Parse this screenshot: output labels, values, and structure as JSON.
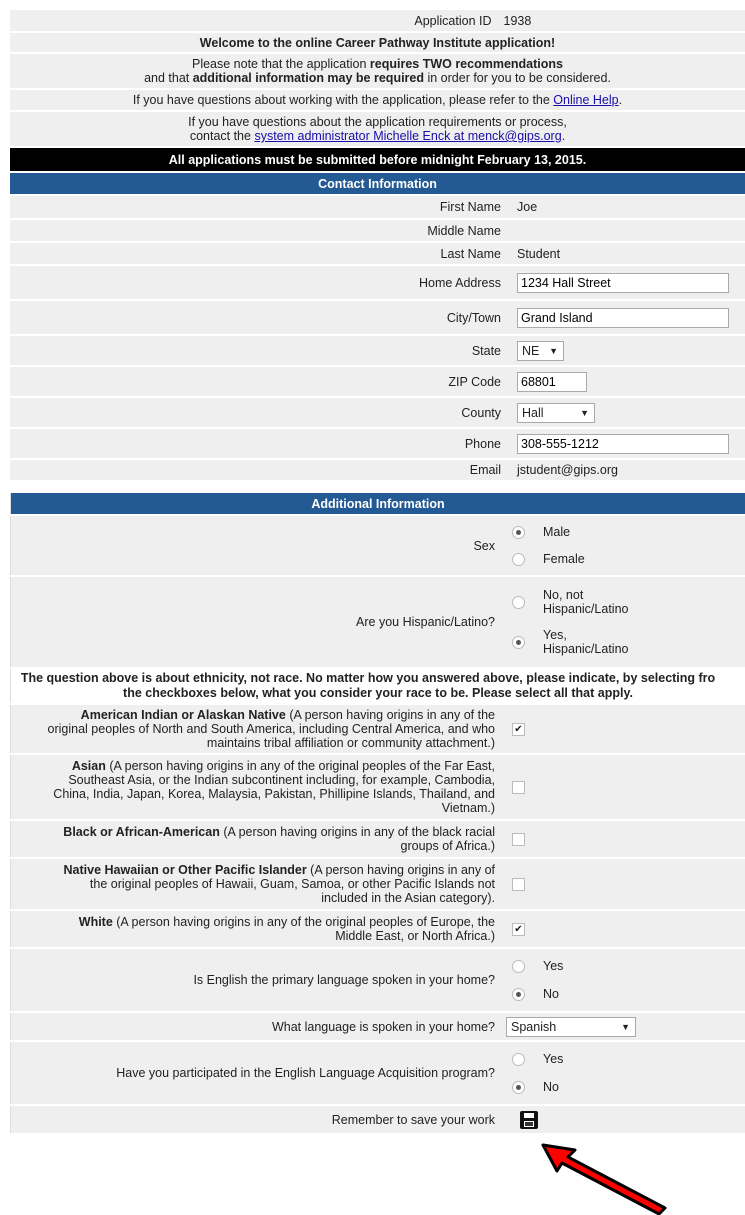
{
  "header": {
    "app_id_label": "Application ID",
    "app_id_value": "1938",
    "welcome": "Welcome to the online Career Pathway Institute application!",
    "note_line1_a": "Please note that the application ",
    "note_line1_b": "requires TWO recommendations",
    "note_line2_a": "and that ",
    "note_line2_b": "additional information may be required",
    "note_line2_c": " in order for you to be considered.",
    "help_text": "If you have questions about working with the application, please refer to the ",
    "help_link": "Online Help",
    "help_end": ".",
    "req_line1": "If you have questions about the application requirements or process,",
    "req_line2_a": "contact the ",
    "req_link": "system administrator Michelle Enck at menck@gips.org",
    "req_end": ".",
    "deadline": "All applications must be submitted before midnight February 13, 2015."
  },
  "contact": {
    "title": "Contact Information",
    "first_name_label": "First Name",
    "first_name": "Joe",
    "middle_name_label": "Middle Name",
    "middle_name": "",
    "last_name_label": "Last Name",
    "last_name": "Student",
    "address_label": "Home Address",
    "address": "1234 Hall Street",
    "city_label": "City/Town",
    "city": "Grand Island",
    "state_label": "State",
    "state": "NE",
    "zip_label": "ZIP Code",
    "zip": "68801",
    "county_label": "County",
    "county": "Hall",
    "phone_label": "Phone",
    "phone": "308-555-1212",
    "email_label": "Email",
    "email": "jstudent@gips.org"
  },
  "additional": {
    "title": "Additional Information",
    "sex_label": "Sex",
    "sex_options": [
      "Male",
      "Female"
    ],
    "sex_selected": "Male",
    "hisp_label": "Are you Hispanic/Latino?",
    "hisp_opt_no_1": "No, not",
    "hisp_opt_no_2": "Hispanic/Latino",
    "hisp_opt_yes_1": "Yes,",
    "hisp_opt_yes_2": "Hispanic/Latino",
    "hisp_selected": "Yes, Hispanic/Latino",
    "race_note_1": "The question above is about ethnicity, not race. No matter how you answered above, please indicate, by selecting fro",
    "race_note_2": "the checkboxes below, what you consider your race to be. Please select all that apply.",
    "races": [
      {
        "name": "American Indian or Alaskan Native",
        "desc_a": " (A person having origins in any of the",
        "desc_b": "original peoples of North and South America, including Central America, and who",
        "desc_c": "maintains tribal affiliation or community attachment.)",
        "desc_d": "",
        "checked": true
      },
      {
        "name": "Asian",
        "desc_a": " (A person having origins in any of the original peoples of the Far East,",
        "desc_b": "Southeast Asia, or the Indian subcontinent including, for example, Cambodia,",
        "desc_c": "China, India, Japan, Korea, Malaysia, Pakistan, Phillipine Islands, Thailand, and",
        "desc_d": "Vietnam.)",
        "checked": false
      },
      {
        "name": "Black or African-American",
        "desc_a": " (A person having origins in any of the black racial",
        "desc_b": "groups of Africa.)",
        "desc_c": "",
        "desc_d": "",
        "checked": false
      },
      {
        "name": "Native Hawaiian or Other Pacific Islander",
        "desc_a": " (A person having origins in any of",
        "desc_b": "the original peoples of Hawaii, Guam, Samoa, or other Pacific Islands not",
        "desc_c": "included in the Asian category).",
        "desc_d": "",
        "checked": false
      },
      {
        "name": "White",
        "desc_a": " (A person having origins in any of the original peoples of Europe, the",
        "desc_b": "Middle East, or North Africa.)",
        "desc_c": "",
        "desc_d": "",
        "checked": true
      }
    ],
    "english_label": "Is English the primary language spoken in your home?",
    "english_options": [
      "Yes",
      "No"
    ],
    "english_selected": "No",
    "language_label": "What language is spoken in your home?",
    "language": "Spanish",
    "ela_label": "Have you participated in the English Language Acquisition program?",
    "ela_options": [
      "Yes",
      "No"
    ],
    "ela_selected": "No",
    "save_label": "Remember to save your work"
  },
  "colors": {
    "header_blue": "#245a93",
    "arrow_red": "#ff0000"
  },
  "icons": {
    "save": "floppy-disk-icon",
    "pointer": "red-arrow-annotation"
  }
}
